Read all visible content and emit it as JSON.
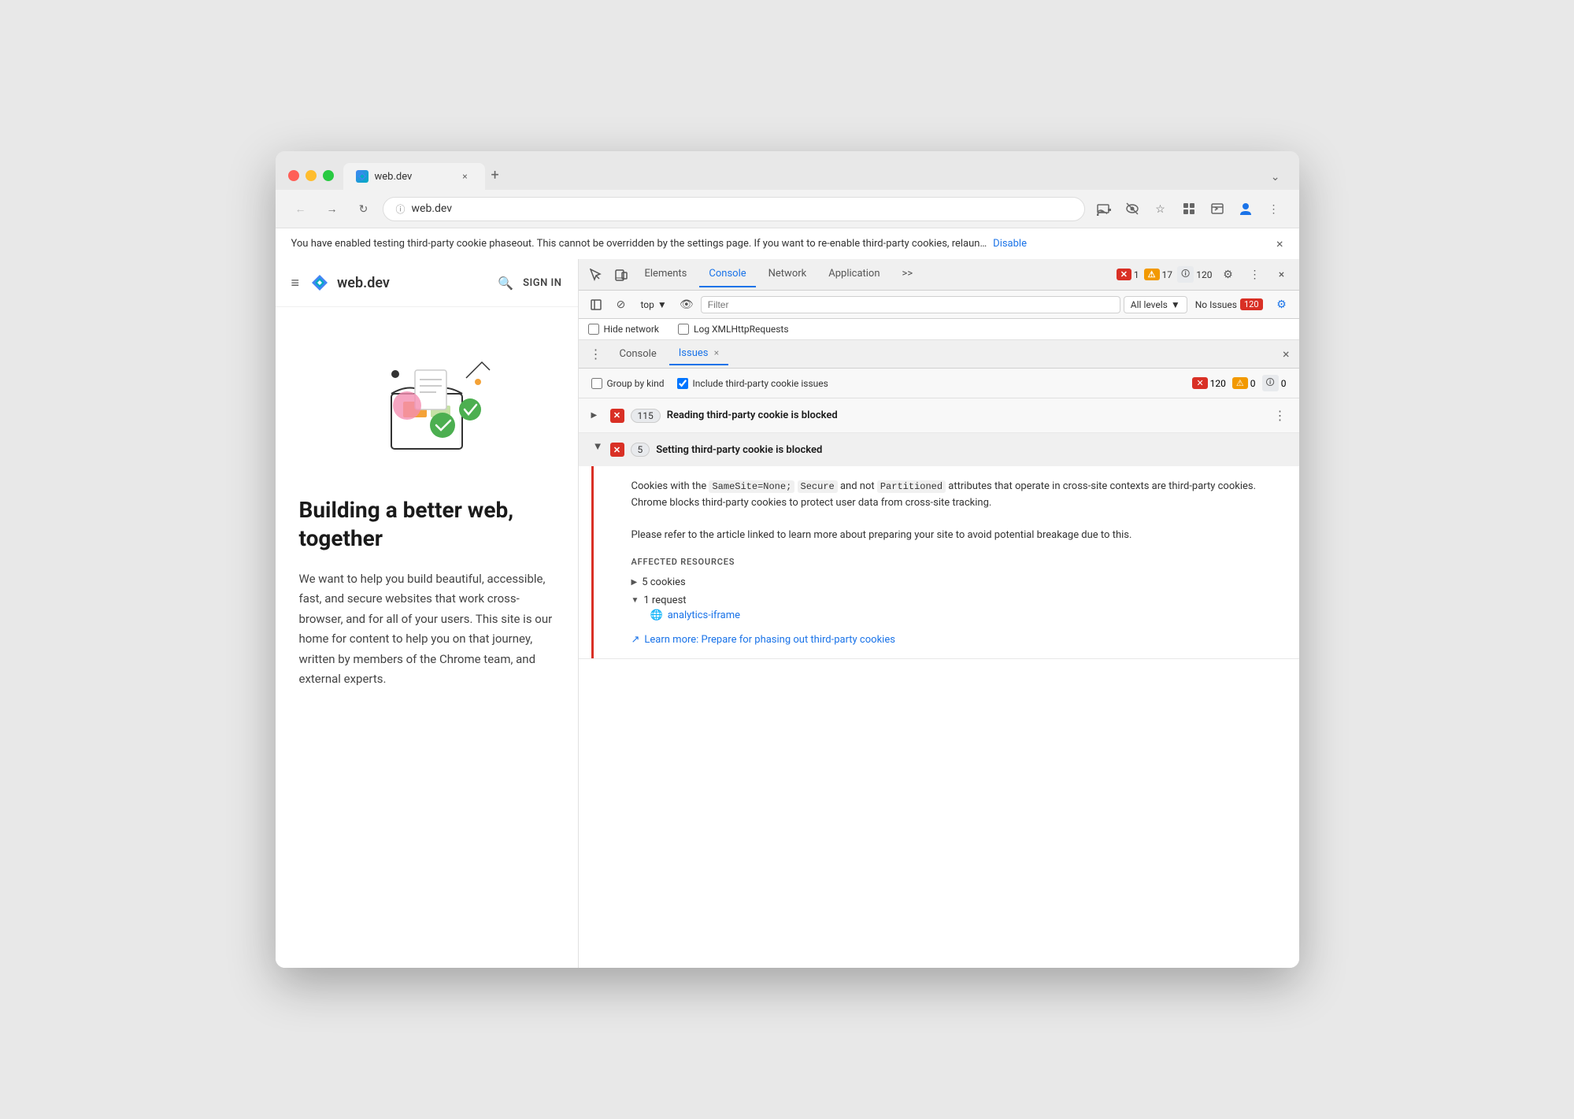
{
  "browser": {
    "tab_title": "web.dev",
    "tab_url": "web.dev",
    "new_tab_symbol": "+",
    "expand_symbol": "⌄"
  },
  "navbar": {
    "back_title": "Back",
    "forward_title": "Forward",
    "reload_title": "Reload",
    "address": "web.dev",
    "cast_title": "Cast",
    "hide_title": "Hide",
    "star_title": "Bookmark",
    "extensions_title": "Extensions",
    "profile_title": "Profile",
    "menu_title": "Menu"
  },
  "infobar": {
    "text": "You have enabled testing third-party cookie phaseout. This cannot be overridden by the settings page. If you want to re-enable third-party cookies, relaun…",
    "link_text": "Disable",
    "close_symbol": "×"
  },
  "website": {
    "menu_symbol": "≡",
    "logo_text": "web.dev",
    "search_symbol": "🔍",
    "signin_text": "SIGN IN",
    "hero_title": "Building a better web, together",
    "hero_body": "We want to help you build beautiful, accessible, fast, and secure websites that work cross-browser, and for all of your users. This site is our home for content to help you on that journey, written by members of the Chrome team, and external experts."
  },
  "devtools": {
    "tabs": [
      {
        "label": "Elements",
        "active": false
      },
      {
        "label": "Console",
        "active": true
      },
      {
        "label": "Network",
        "active": false
      },
      {
        "label": "Application",
        "active": false
      }
    ],
    "more_tabs_symbol": ">>",
    "error_count": "1",
    "warning_count": "17",
    "info_count": "120",
    "settings_symbol": "⚙",
    "menu_symbol": "⋮",
    "close_symbol": "×",
    "toolbar_icons": {
      "inspect": "⬚",
      "device": "⬜",
      "no_ban": "⊘",
      "top_label": "top",
      "eye": "👁",
      "filter_placeholder": "Filter",
      "all_levels": "All levels",
      "no_issues": "No Issues",
      "no_issues_count": "120",
      "settings_blue": "⚙"
    },
    "checkboxes": {
      "hide_network": "Hide network",
      "log_xml": "Log XMLHttpRequests"
    },
    "subtabs": {
      "console_label": "Console",
      "issues_label": "Issues",
      "close_symbol": "×"
    },
    "issues": {
      "filter": {
        "group_by_kind": "Group by kind",
        "include_third_party": "Include third-party cookie issues",
        "count_error": "120",
        "count_warning": "0",
        "count_info": "0"
      },
      "groups": [
        {
          "expanded": false,
          "count": "115",
          "title": "Reading third-party cookie is blocked",
          "menu_symbol": "⋮"
        },
        {
          "expanded": true,
          "count": "5",
          "title": "Setting third-party cookie is blocked",
          "description_html": true,
          "description": "Cookies with the SameSite=None; Secure and not Partitioned attributes that operate in cross-site contexts are third-party cookies. Chrome blocks third-party cookies to protect user data from cross-site tracking.\n\nPlease refer to the article linked to learn more about preparing your site to avoid potential breakage due to this.",
          "description_codes": [
            "SameSite=None;",
            "Secure",
            "Partitioned"
          ],
          "affected_resources_title": "AFFECTED RESOURCES",
          "resources": [
            {
              "type": "cookies",
              "count": "5",
              "label": "5 cookies",
              "expanded": false
            },
            {
              "type": "request",
              "count": "1",
              "label": "1 request",
              "expanded": true,
              "children": [
                {
                  "label": "analytics-iframe",
                  "icon": "🌐"
                }
              ]
            }
          ],
          "learn_more_label": "Learn more: Prepare for phasing out third-party cookies",
          "learn_more_icon": "↗"
        }
      ]
    }
  }
}
